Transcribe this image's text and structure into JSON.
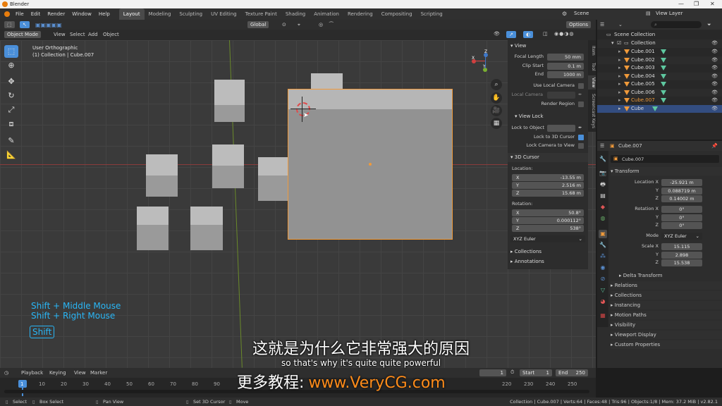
{
  "window": {
    "title": "Blender"
  },
  "menu": [
    "File",
    "Edit",
    "Render",
    "Window",
    "Help"
  ],
  "workspaces": [
    "Layout",
    "Modeling",
    "Sculpting",
    "UV Editing",
    "Texture Paint",
    "Shading",
    "Animation",
    "Rendering",
    "Compositing",
    "Scripting"
  ],
  "scene": {
    "label": "Scene",
    "view_layer": "View Layer"
  },
  "viewport_header": {
    "mode": "Object Mode",
    "menus": [
      "View",
      "Select",
      "Add",
      "Object"
    ],
    "orientation": "Global",
    "options": "Options"
  },
  "viewport": {
    "view_name": "User Orthographic",
    "collection_info": "(1) Collection | Cube.007"
  },
  "gizmo": {
    "x": "X",
    "y": "Y",
    "z": "Z"
  },
  "npanel": {
    "tabs": [
      "Item",
      "Tool",
      "View",
      "Screencast Keys"
    ],
    "view_section": "View",
    "focal_length_label": "Focal Length",
    "focal_length": "50 mm",
    "clip_start_label": "Clip Start",
    "clip_start": "0.1 m",
    "end_label": "End",
    "end": "1000 m",
    "use_local_camera": "Use Local Camera",
    "local_camera": "Local Camera",
    "render_region": "Render Region",
    "view_lock": "View Lock",
    "lock_to_object": "Lock to Object",
    "lock_to_cursor": "Lock to 3D Cursor",
    "lock_camera": "Lock Camera to View",
    "cursor_section": "3D Cursor",
    "location_label": "Location:",
    "loc": [
      {
        "axis": "X",
        "value": "-13.55 m"
      },
      {
        "axis": "Y",
        "value": "2.516 m"
      },
      {
        "axis": "Z",
        "value": "15.68 m"
      }
    ],
    "rotation_label": "Rotation:",
    "rot": [
      {
        "axis": "X",
        "value": "50.8°"
      },
      {
        "axis": "Y",
        "value": "0.000112°"
      },
      {
        "axis": "Z",
        "value": "538°"
      }
    ],
    "rot_mode": "XYZ Euler",
    "collections": "Collections",
    "annotations": "Annotations"
  },
  "outliner": {
    "scene_collection": "Scene Collection",
    "collection": "Collection",
    "items": [
      "Cube.001",
      "Cube.002",
      "Cube.003",
      "Cube.004",
      "Cube.005",
      "Cube.006",
      "Cube.007",
      "Cube"
    ]
  },
  "properties": {
    "object_name": "Cube.007",
    "name_field": "Cube.007",
    "transform": "Transform",
    "location_label": "Location X",
    "location": [
      "-25.921 m",
      "0.088719 m",
      "0.14002 m"
    ],
    "rotation_label": "Rotation X",
    "rotation": [
      "0°",
      "0°",
      "0°"
    ],
    "mode_label": "Mode",
    "mode": "XYZ Euler",
    "scale_label": "Scale X",
    "scale": [
      "15.115",
      "2.898",
      "15.538"
    ],
    "y_label": "Y",
    "z_label": "Z",
    "delta": "Delta Transform",
    "sections": [
      "Relations",
      "Collections",
      "Instancing",
      "Motion Paths",
      "Visibility",
      "Viewport Display",
      "Custom Properties"
    ]
  },
  "timeline": {
    "menus": [
      "Playback",
      "Keying",
      "View",
      "Marker"
    ],
    "current_frame": "1",
    "start_label": "Start",
    "start": "1",
    "end_label": "End",
    "end": "250",
    "ticks": [
      "1",
      "10",
      "20",
      "30",
      "40",
      "50",
      "60",
      "70",
      "80",
      "90",
      "220",
      "230",
      "240",
      "250"
    ]
  },
  "status": {
    "select": "Select",
    "box_select": "Box Select",
    "pan_view": "Pan View",
    "set_cursor": "Set 3D Cursor",
    "move": "Move",
    "info": "Collection | Cube.007 | Verts:64 | Faces:48 | Tris:96 | Objects:1/8 | Mem: 37.2 MiB | v2.82.1"
  },
  "overlay": {
    "hint1": "Shift + Middle Mouse",
    "hint2": "Shift + Right Mouse",
    "key": "Shift",
    "subtitle_cn": "这就是为什么它非常强大的原因",
    "subtitle_en": "so that's why it's quite quite powerful",
    "watermark_cn": "更多教程:",
    "watermark_url": "www.VeryCG.com"
  },
  "colors": {
    "accent": "#4a8fd9",
    "selection": "#f09a3a",
    "hint": "#29b6f6",
    "watermark": "#ff8c1a"
  }
}
